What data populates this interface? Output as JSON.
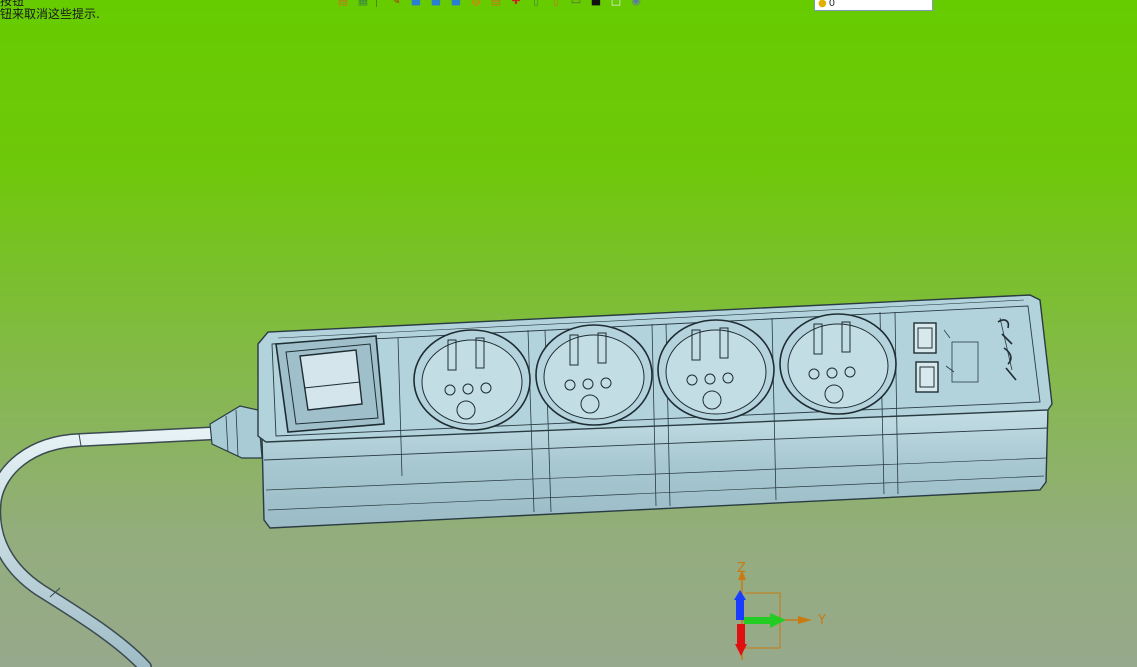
{
  "hint": {
    "line1": "按钮",
    "line2": "钮来取消这些提示."
  },
  "toolbar": {
    "icons": [
      "open-icon",
      "save-icon",
      "pen-icon",
      "cube-icon",
      "cube-blue-icon",
      "cube-shaded-icon",
      "sphere-icon",
      "sheet-icon",
      "snap-icon",
      "page-icon",
      "layer-icon",
      "printer-icon",
      "black-square-icon",
      "white-square-icon",
      "disk-icon"
    ],
    "glyphs": [
      "▤",
      "▦",
      "✎",
      "■",
      "■",
      "■",
      "◍",
      "▤",
      "✚",
      "▯",
      "▯",
      "▭",
      "■",
      "□",
      "◉"
    ]
  },
  "search": {
    "icon": "bulb-icon",
    "value": "0"
  },
  "triad": {
    "z_label": "Z",
    "y_label": "Y"
  },
  "colors": {
    "background_top": "#66cc00",
    "background_bottom": "#97a98c",
    "model_fill": "#a9cbd6",
    "model_edge": "#2a3b42",
    "axis_z": "#1a3cff",
    "axis_y": "#22cc22",
    "axis_x": "#e01010"
  }
}
